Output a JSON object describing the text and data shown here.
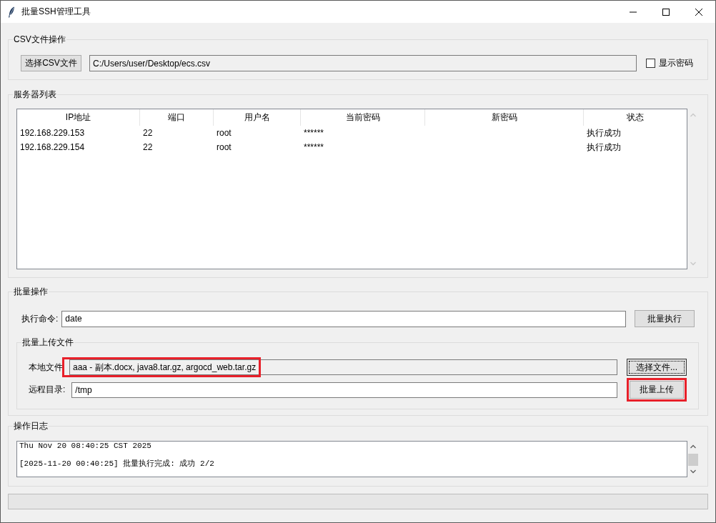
{
  "window": {
    "title": "批量SSH管理工具"
  },
  "csv_group": {
    "title": "CSV文件操作",
    "choose_button": "选择CSV文件",
    "path": "C:/Users/user/Desktop/ecs.csv",
    "show_password": {
      "label": "显示密码",
      "checked": false
    }
  },
  "servers": {
    "title": "服务器列表",
    "columns": [
      "IP地址",
      "端口",
      "用户名",
      "当前密码",
      "新密码",
      "状态"
    ],
    "rows": [
      {
        "ip": "192.168.229.153",
        "port": "22",
        "username": "root",
        "current_password": "******",
        "status": "执行成功"
      },
      {
        "ip": "192.168.229.154",
        "port": "22",
        "username": "root",
        "current_password": "******",
        "status": "执行成功"
      }
    ]
  },
  "batch": {
    "title": "批量操作",
    "command_label": "执行命令:",
    "command": "date",
    "execute_button": "批量执行",
    "upload": {
      "title": "批量上传文件",
      "local_label": "本地文件",
      "local_files": {
        "value": "aaa - 副本.docx, java8.tar.gz, argocd_web.tar.gz",
        "highlighted": true
      },
      "choose_button": {
        "label": "选择文件...",
        "focused": true
      },
      "remote_label": "远程目录:",
      "remote_dir": "/tmp",
      "upload_button": {
        "label": "批量上传",
        "highlighted": true
      }
    }
  },
  "log": {
    "title": "操作日志",
    "lines": [
      "Thu Nov 20 08:40:25 CST 2025",
      "[2025-11-20 00:40:25] 批量执行完成: 成功 2/2"
    ]
  }
}
